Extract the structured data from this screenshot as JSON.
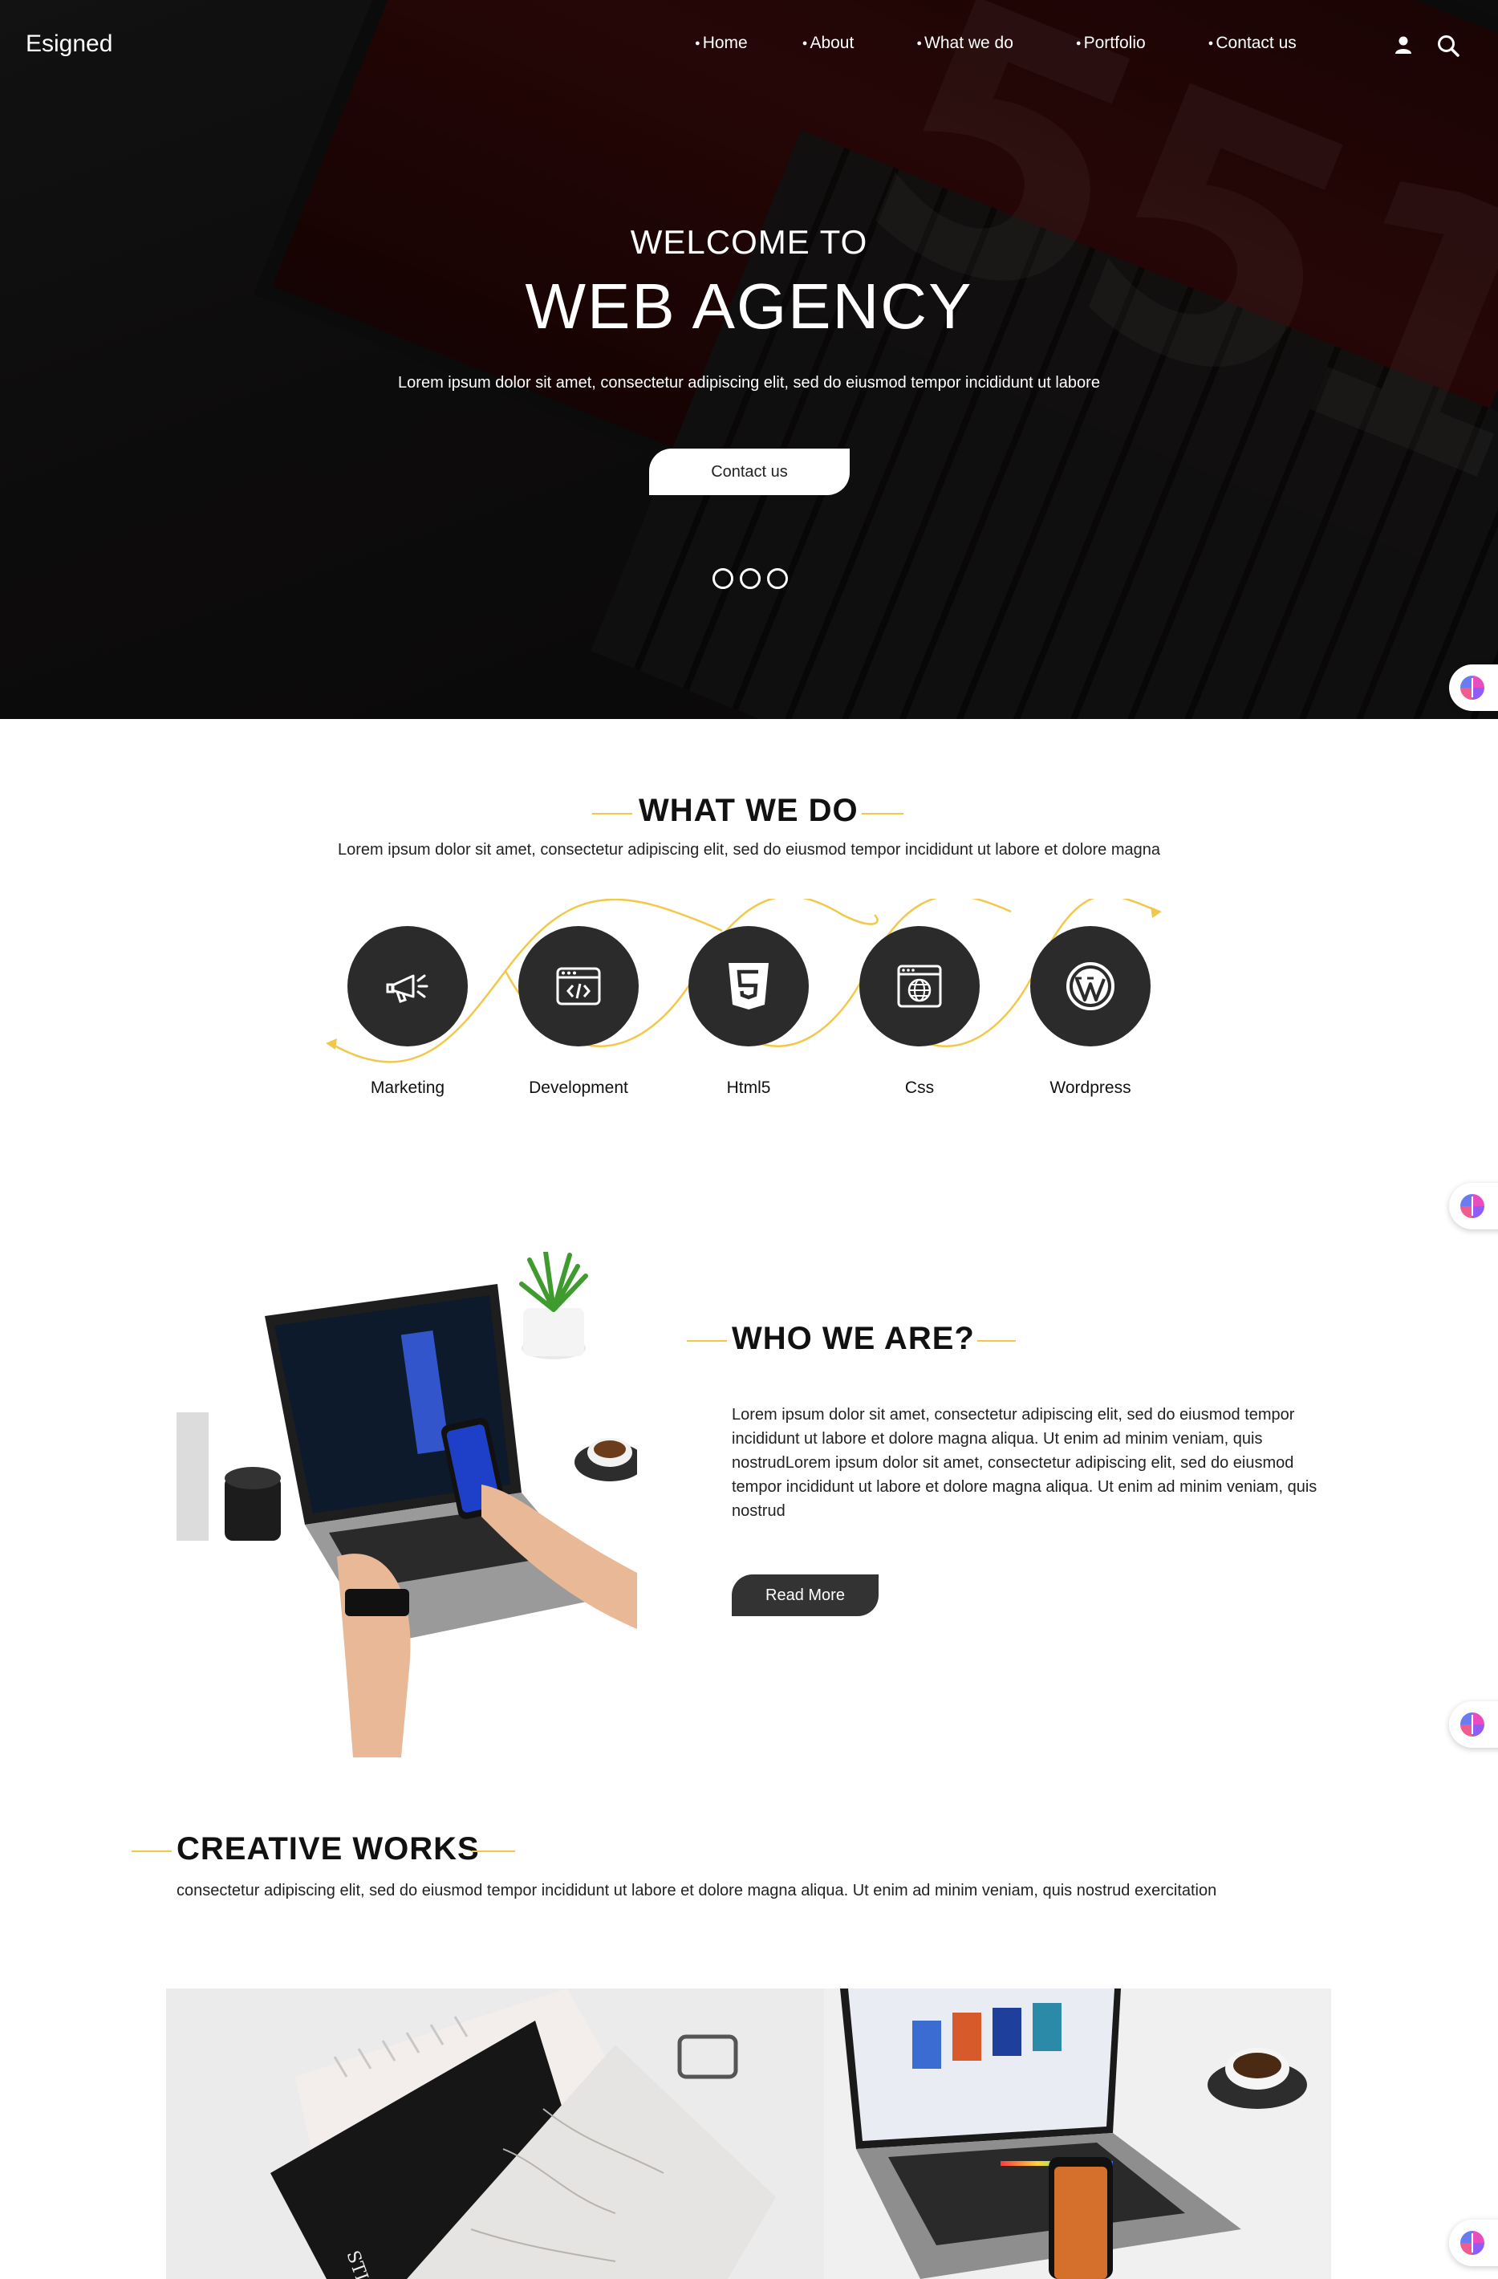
{
  "nav": {
    "brand": "Esigned",
    "menu": [
      "Home",
      "About",
      "What we do",
      "Portfolio",
      "Contact us"
    ],
    "user_icon": "user-icon",
    "search_icon": "search-icon"
  },
  "hero": {
    "subtitle": "WELCOME TO",
    "title": "WEB AGENCY",
    "text": "Lorem ipsum dolor sit amet, consectetur adipiscing elit, sed do eiusmod tempor incididunt ut labore",
    "button": "Contact us",
    "slide_count": 3
  },
  "what_we_do": {
    "title": "WHAT WE DO",
    "text": "Lorem ipsum dolor sit amet, consectetur adipiscing elit, sed do eiusmod tempor incididunt ut labore et dolore magna",
    "services": [
      {
        "label": "Marketing",
        "icon": "megaphone-icon"
      },
      {
        "label": "Development",
        "icon": "code-window-icon"
      },
      {
        "label": "Html5",
        "icon": "html5-icon"
      },
      {
        "label": "Css",
        "icon": "globe-window-icon"
      },
      {
        "label": "Wordpress",
        "icon": "wordpress-icon"
      }
    ]
  },
  "who_we_are": {
    "title": "WHO WE ARE?",
    "text": "Lorem ipsum dolor sit amet, consectetur adipiscing elit, sed do eiusmod tempor incididunt ut labore et dolore magna aliqua. Ut enim ad minim veniam, quis nostrudLorem ipsum dolor sit amet, consectetur adipiscing elit, sed do eiusmod tempor incididunt ut labore et dolore magna aliqua. Ut enim ad minim veniam, quis nostrud",
    "button": "Read More"
  },
  "creative_works": {
    "title": "CREATIVE WORKS",
    "text": "consectetur adipiscing elit, sed do eiusmod tempor incididunt ut labore et dolore magna aliqua. Ut enim ad minim veniam, quis nostrud exercitation"
  },
  "side_widget_icon": "brain-icon",
  "colors": {
    "accent": "#f2c84b",
    "dark": "#2b2b2b",
    "hero_red": "#3b0b0b"
  }
}
